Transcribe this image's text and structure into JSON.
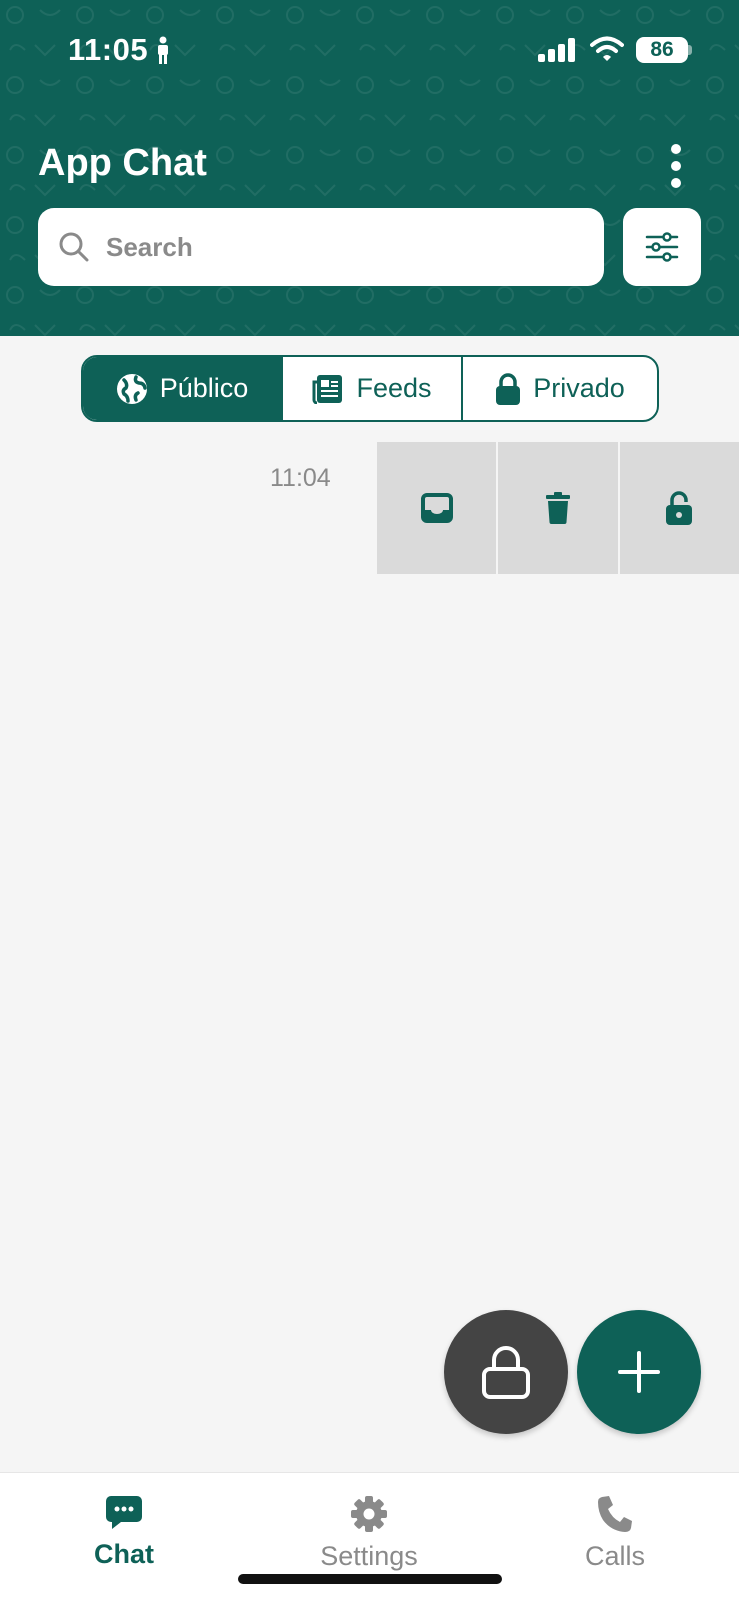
{
  "status_bar": {
    "time": "11:05",
    "battery": "86"
  },
  "header": {
    "title": "App Chat"
  },
  "search": {
    "placeholder": "Search"
  },
  "tabs": [
    {
      "label": "Público",
      "icon": "globe-icon",
      "active": true
    },
    {
      "label": "Feeds",
      "icon": "newspaper-icon",
      "active": false
    },
    {
      "label": "Privado",
      "icon": "lock-icon",
      "active": false
    }
  ],
  "chat_row": {
    "time": "11:04",
    "actions": [
      "inbox-icon",
      "trash-icon",
      "unlock-icon"
    ]
  },
  "fabs": [
    "lock-icon",
    "plus-icon"
  ],
  "bottom_nav": [
    {
      "label": "Chat",
      "icon": "chat-bubble-icon",
      "active": true
    },
    {
      "label": "Settings",
      "icon": "gear-icon",
      "active": false
    },
    {
      "label": "Calls",
      "icon": "phone-icon",
      "active": false
    }
  ],
  "colors": {
    "primary": "#0e6157",
    "fab_dark": "#444444",
    "background": "#f5f5f5",
    "action_bg": "#dadada",
    "muted_text": "#8a8a8a"
  }
}
